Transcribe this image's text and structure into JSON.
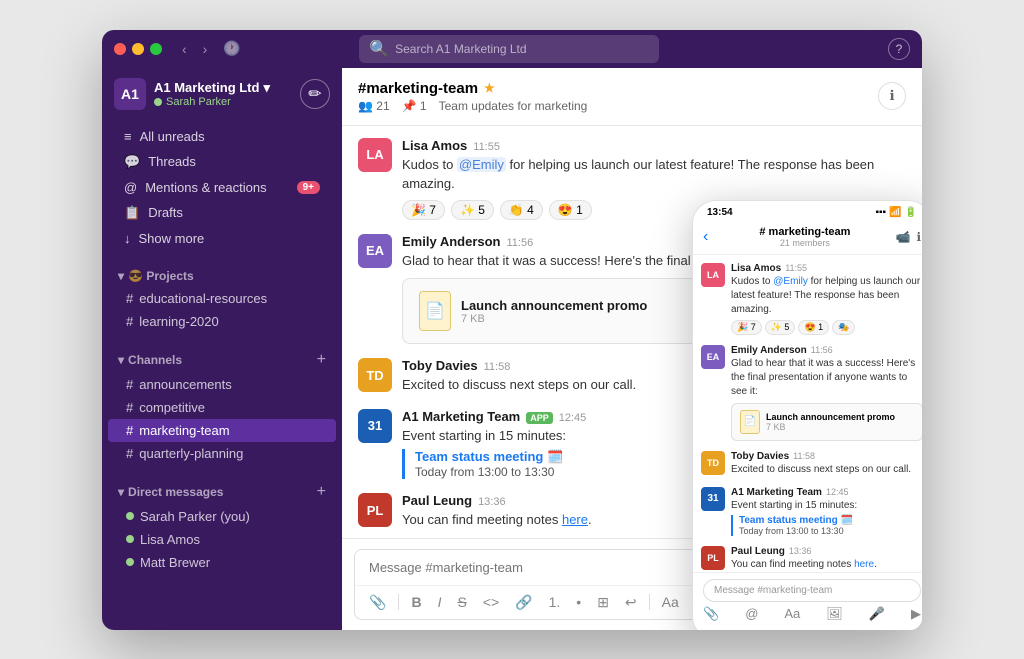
{
  "app": {
    "title": "A1 Marketing Ltd",
    "search_placeholder": "Search A1 Marketing Ltd",
    "user": "Sarah Parker",
    "user_status": "online"
  },
  "sidebar": {
    "workspace": "A1 Marketing Ltd",
    "user_name": "Sarah Parker",
    "nav_items": [
      {
        "id": "all-unreads",
        "label": "All unreads",
        "icon": "≡",
        "badge": null
      },
      {
        "id": "threads",
        "label": "Threads",
        "icon": "💬",
        "badge": null
      },
      {
        "id": "mentions",
        "label": "Mentions & reactions",
        "icon": "@",
        "badge": "9+"
      },
      {
        "id": "drafts",
        "label": "Drafts",
        "icon": "📋",
        "badge": null
      }
    ],
    "show_more": "Show more",
    "projects_section": "Projects",
    "projects": [
      {
        "name": "educational-resources"
      },
      {
        "name": "learning-2020"
      }
    ],
    "channels_section": "Channels",
    "channels": [
      {
        "name": "announcements"
      },
      {
        "name": "competitive"
      },
      {
        "name": "marketing-team",
        "active": true
      },
      {
        "name": "quarterly-planning"
      }
    ],
    "dm_section": "Direct messages",
    "dms": [
      {
        "name": "Sarah Parker (you)",
        "color": "#9ad48a"
      },
      {
        "name": "Lisa Amos",
        "color": "#9ad48a"
      },
      {
        "name": "Matt Brewer",
        "color": "#9ad48a"
      }
    ]
  },
  "channel": {
    "name": "#marketing-team",
    "description": "Team updates for marketing",
    "member_count": "21",
    "pinned_count": "1"
  },
  "messages": [
    {
      "id": "msg1",
      "sender": "Lisa Amos",
      "time": "11:55",
      "avatar_color": "#e8516f",
      "avatar_initials": "LA",
      "text_parts": [
        {
          "type": "text",
          "content": "Kudos to "
        },
        {
          "type": "mention",
          "content": "@Emily"
        },
        {
          "type": "text",
          "content": " for helping us launch our latest feature! The response has been amazing."
        }
      ],
      "reactions": [
        {
          "emoji": "🎉",
          "count": "7"
        },
        {
          "emoji": "✨",
          "count": "5"
        },
        {
          "emoji": "👏",
          "count": "4"
        },
        {
          "emoji": "😍",
          "count": "1"
        }
      ]
    },
    {
      "id": "msg2",
      "sender": "Emily Anderson",
      "time": "11:56",
      "avatar_color": "#7c5cbf",
      "avatar_initials": "EA",
      "text": "Glad to hear that it was a success! Here's the final presentation if anyone wants to se...",
      "attachment": {
        "name": "Launch announcement promo",
        "size": "7 KB",
        "icon": "📄"
      }
    },
    {
      "id": "msg3",
      "sender": "Toby Davies",
      "time": "11:58",
      "avatar_color": "#e8a020",
      "avatar_initials": "TD",
      "text": "Excited to discuss next steps on our call."
    },
    {
      "id": "msg4",
      "sender": "A1 Marketing Team",
      "time": "12:45",
      "is_app": true,
      "app_label": "APP",
      "avatar_color": "#1a5fb4",
      "avatar_initials": "31",
      "text": "Event starting in 15 minutes:",
      "event": {
        "title": "Team status meeting 🗓️",
        "time": "Today from 13:00 to 13:30"
      }
    },
    {
      "id": "msg5",
      "sender": "Paul Leung",
      "time": "13:36",
      "avatar_color": "#c0392b",
      "avatar_initials": "PL",
      "text_parts": [
        {
          "type": "text",
          "content": "You can find meeting notes "
        },
        {
          "type": "link",
          "content": "here"
        },
        {
          "type": "text",
          "content": "."
        }
      ]
    }
  ],
  "message_input": {
    "placeholder": "Message #marketing-team"
  },
  "toolbar": {
    "buttons": [
      "+",
      "B",
      "I",
      "S",
      "<>",
      "🔗",
      "1.",
      "•",
      "⊞",
      "↩"
    ]
  },
  "phone": {
    "time": "13:54",
    "channel_name": "# marketing-team",
    "member_count": "21 members",
    "messages_input_placeholder": "Message #marketing-team"
  }
}
